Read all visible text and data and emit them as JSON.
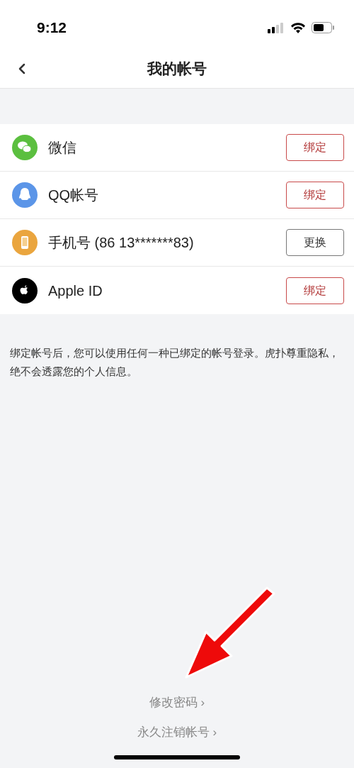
{
  "status_bar": {
    "time": "9:12"
  },
  "nav": {
    "title": "我的帐号"
  },
  "accounts": [
    {
      "name": "微信",
      "kind": "wechat",
      "action": {
        "label": "绑定",
        "kind": "bind"
      }
    },
    {
      "name": "QQ帐号",
      "kind": "qq",
      "action": {
        "label": "绑定",
        "kind": "bind"
      }
    },
    {
      "name": "手机号 (86 13*******83)",
      "kind": "phone",
      "action": {
        "label": "更换",
        "kind": "change"
      }
    },
    {
      "name": "Apple ID",
      "kind": "apple",
      "action": {
        "label": "绑定",
        "kind": "bind"
      }
    }
  ],
  "note": "绑定帐号后，您可以使用任何一种已绑定的帐号登录。虎扑尊重隐私，绝不会透露您的个人信息。",
  "links": [
    {
      "label": "修改密码",
      "chevron": "›"
    },
    {
      "label": "永久注销帐号",
      "chevron": "›"
    }
  ]
}
